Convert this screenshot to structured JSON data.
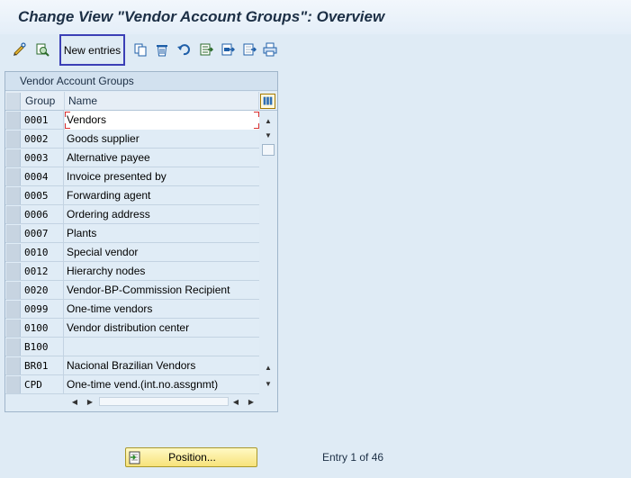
{
  "title": "Change View \"Vendor Account Groups\": Overview",
  "toolbar": {
    "icons": [
      "display-change-icon",
      "details-icon",
      "copy-icon",
      "delete-icon",
      "undo-icon",
      "select-all-icon",
      "select-block-icon",
      "deselect-all-icon",
      "print-icon"
    ],
    "new_entries_label": "New entries"
  },
  "table": {
    "title": "Vendor Account Groups",
    "columns": [
      "Group",
      "Name"
    ],
    "rows": [
      {
        "group": "0001",
        "name": "Vendors"
      },
      {
        "group": "0002",
        "name": "Goods supplier"
      },
      {
        "group": "0003",
        "name": "Alternative payee"
      },
      {
        "group": "0004",
        "name": "Invoice presented by"
      },
      {
        "group": "0005",
        "name": "Forwarding agent"
      },
      {
        "group": "0006",
        "name": "Ordering address"
      },
      {
        "group": "0007",
        "name": "Plants"
      },
      {
        "group": "0010",
        "name": "Special vendor"
      },
      {
        "group": "0012",
        "name": "Hierarchy nodes"
      },
      {
        "group": "0020",
        "name": "Vendor-BP-Commission Recipient"
      },
      {
        "group": "0099",
        "name": "One-time vendors"
      },
      {
        "group": "0100",
        "name": "Vendor distribution center"
      },
      {
        "group": "B100",
        "name": ""
      },
      {
        "group": "BR01",
        "name": "Nacional Brazilian Vendors"
      },
      {
        "group": "CPD",
        "name": "One-time vend.(int.no.assgnmt)"
      }
    ]
  },
  "position_button_label": "Position...",
  "entry_info": "Entry 1 of 46",
  "colors": {
    "accent_border": "#3b3fb6",
    "focus": "#d93030",
    "position_button": "#f7e27a"
  }
}
